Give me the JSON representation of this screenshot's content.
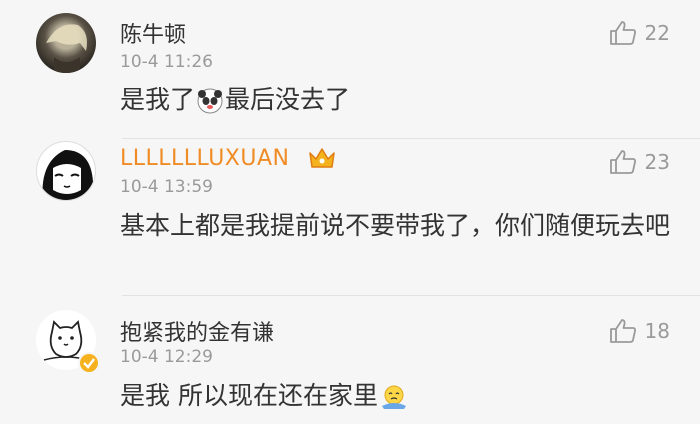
{
  "comments": [
    {
      "username": "陈牛顿",
      "time": "10-4 11:26",
      "text_before": "是我了",
      "emoji": "panda-face-emoji",
      "text_after": "最后没去了",
      "likes": "22"
    },
    {
      "username": "LLLLLLLUXUAN",
      "vip_badge": "crown-icon",
      "time": "10-4 13:59",
      "text": "基本上都是我提前说不要带我了，你们随便玩去吧",
      "likes": "23"
    },
    {
      "username": "抱紧我的金有谦",
      "verified_badge": "verified-badge-icon",
      "time": "10-4 12:29",
      "text": "是我 所以现在还在家里",
      "emoji": "lonely-face-emoji",
      "likes": "18"
    }
  ],
  "colors": {
    "background": "#f6f6f6",
    "vip_username": "#f08c26",
    "meta": "#9a9a9a",
    "text": "#333333"
  }
}
